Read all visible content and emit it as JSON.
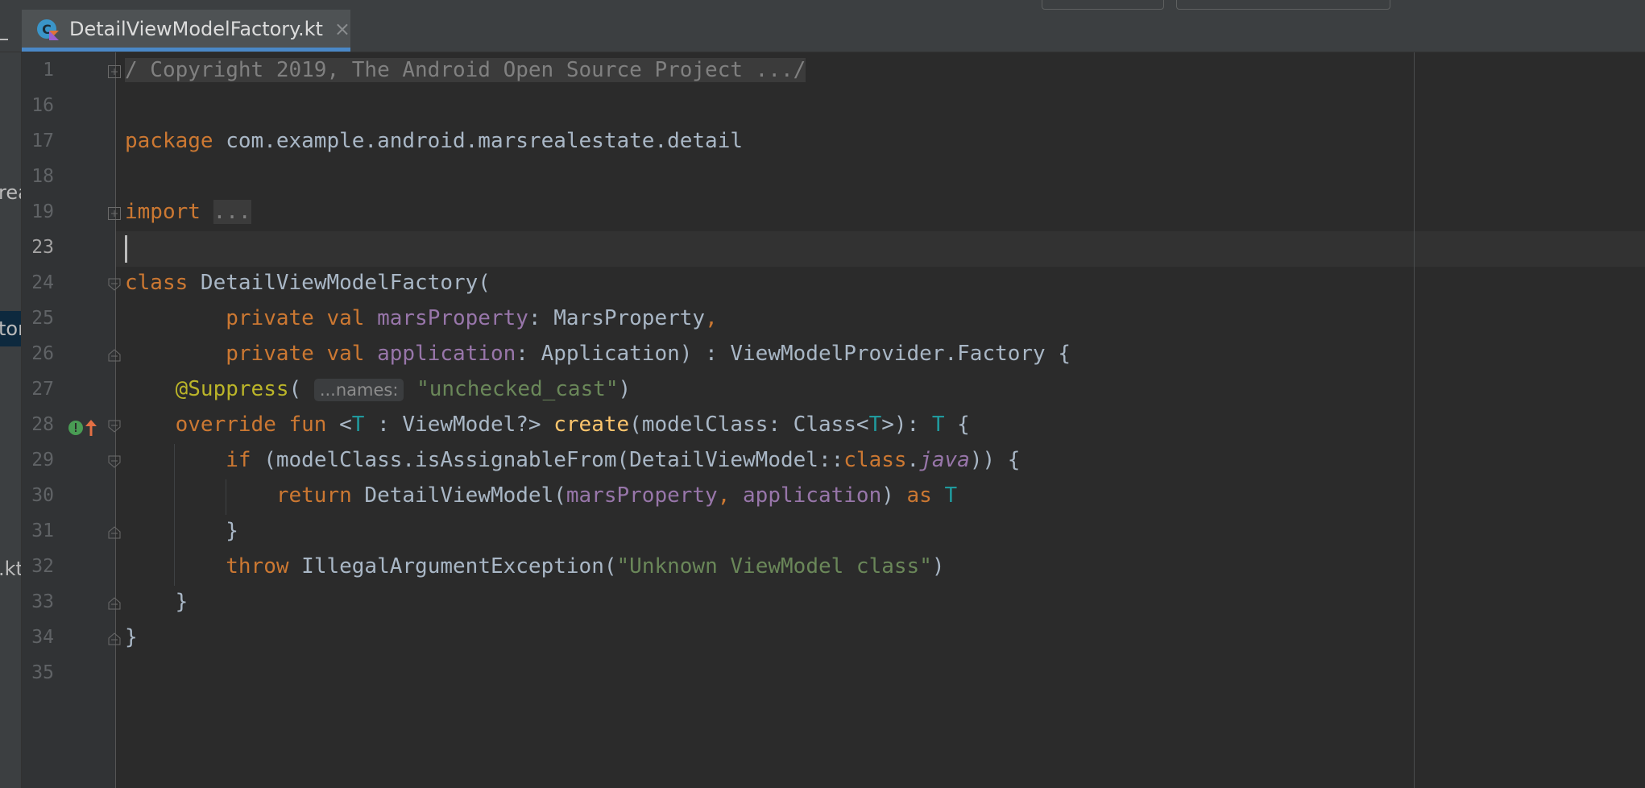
{
  "editor": {
    "tab": {
      "file_name": "DetailViewModelFactory.kt",
      "close_glyph": "×",
      "icon": "kotlin-class-file-icon"
    },
    "left_panel_fragments": [
      "rea",
      "tor",
      ".kt"
    ],
    "current_line": "23",
    "lines": [
      {
        "n": "1",
        "tokens": [
          {
            "t": "/ Copyright 2019, The Android Open Source Project .../",
            "c": "folded"
          }
        ]
      },
      {
        "n": "16",
        "tokens": []
      },
      {
        "n": "17",
        "tokens": [
          {
            "t": "package",
            "c": "kw"
          },
          {
            "t": " com.example.android.marsrealestate.detail",
            "c": ""
          }
        ]
      },
      {
        "n": "18",
        "tokens": []
      },
      {
        "n": "19",
        "tokens": [
          {
            "t": "import",
            "c": "kw"
          },
          {
            "t": " ",
            "c": ""
          },
          {
            "t": "...",
            "c": "folded"
          }
        ]
      },
      {
        "n": "23",
        "tokens": []
      },
      {
        "n": "24",
        "tokens": [
          {
            "t": "class",
            "c": "kw"
          },
          {
            "t": " DetailViewModelFactory(",
            "c": ""
          }
        ]
      },
      {
        "n": "25",
        "tokens": [
          {
            "t": "        ",
            "c": ""
          },
          {
            "t": "private val",
            "c": "kw"
          },
          {
            "t": " ",
            "c": ""
          },
          {
            "t": "marsProperty",
            "c": "prop"
          },
          {
            "t": ": MarsProperty",
            "c": ""
          },
          {
            "t": ",",
            "c": "kw"
          }
        ]
      },
      {
        "n": "26",
        "tokens": [
          {
            "t": "        ",
            "c": ""
          },
          {
            "t": "private val",
            "c": "kw"
          },
          {
            "t": " ",
            "c": ""
          },
          {
            "t": "application",
            "c": "prop"
          },
          {
            "t": ": Application) : ViewModelProvider.Factory {",
            "c": ""
          }
        ]
      },
      {
        "n": "27",
        "tokens": [
          {
            "t": "    ",
            "c": ""
          },
          {
            "t": "@Suppress",
            "c": "ann"
          },
          {
            "t": "( ",
            "c": ""
          },
          {
            "t": "...names:",
            "c": "hint"
          },
          {
            "t": " ",
            "c": ""
          },
          {
            "t": "\"unchecked_cast\"",
            "c": "str"
          },
          {
            "t": ")",
            "c": ""
          }
        ]
      },
      {
        "n": "28",
        "tokens": [
          {
            "t": "    ",
            "c": ""
          },
          {
            "t": "override fun",
            "c": "kw"
          },
          {
            "t": " <",
            "c": ""
          },
          {
            "t": "T",
            "c": "tp"
          },
          {
            "t": " : ViewModel?> ",
            "c": ""
          },
          {
            "t": "create",
            "c": "fn"
          },
          {
            "t": "(modelClass: Class<",
            "c": ""
          },
          {
            "t": "T",
            "c": "tp"
          },
          {
            "t": ">): ",
            "c": ""
          },
          {
            "t": "T",
            "c": "tp"
          },
          {
            "t": " {",
            "c": ""
          }
        ]
      },
      {
        "n": "29",
        "tokens": [
          {
            "t": "        ",
            "c": ""
          },
          {
            "t": "if",
            "c": "kw"
          },
          {
            "t": " (modelClass.isAssignableFrom(DetailViewModel::",
            "c": ""
          },
          {
            "t": "class",
            "c": "kw"
          },
          {
            "t": ".",
            "c": ""
          },
          {
            "t": "java",
            "c": "it"
          },
          {
            "t": ")) {",
            "c": ""
          }
        ]
      },
      {
        "n": "30",
        "tokens": [
          {
            "t": "            ",
            "c": ""
          },
          {
            "t": "return",
            "c": "kw"
          },
          {
            "t": " DetailViewModel(",
            "c": ""
          },
          {
            "t": "marsProperty",
            "c": "prop"
          },
          {
            "t": ", ",
            "c": "kw"
          },
          {
            "t": "application",
            "c": "prop"
          },
          {
            "t": ") ",
            "c": ""
          },
          {
            "t": "as",
            "c": "kw"
          },
          {
            "t": " ",
            "c": ""
          },
          {
            "t": "T",
            "c": "tp"
          }
        ]
      },
      {
        "n": "31",
        "tokens": [
          {
            "t": "        }",
            "c": ""
          }
        ]
      },
      {
        "n": "32",
        "tokens": [
          {
            "t": "        ",
            "c": ""
          },
          {
            "t": "throw",
            "c": "kw"
          },
          {
            "t": " IllegalArgumentException(",
            "c": ""
          },
          {
            "t": "\"Unknown ViewModel class\"",
            "c": "str"
          },
          {
            "t": ")",
            "c": ""
          }
        ]
      },
      {
        "n": "33",
        "tokens": [
          {
            "t": "    }",
            "c": ""
          }
        ]
      },
      {
        "n": "34",
        "tokens": [
          {
            "t": "}",
            "c": ""
          }
        ]
      },
      {
        "n": "35",
        "tokens": []
      }
    ],
    "gutter_markers": {
      "line_28": "implements-overrides-icon"
    },
    "colors": {
      "background": "#2b2b2b",
      "gutter": "#313335",
      "keyword": "#cc7832",
      "property": "#9876aa",
      "string": "#6a8759",
      "annotation": "#bbb529",
      "function": "#ffc66d",
      "type_param": "#20999d",
      "tab_underline": "#4a88c7"
    }
  }
}
